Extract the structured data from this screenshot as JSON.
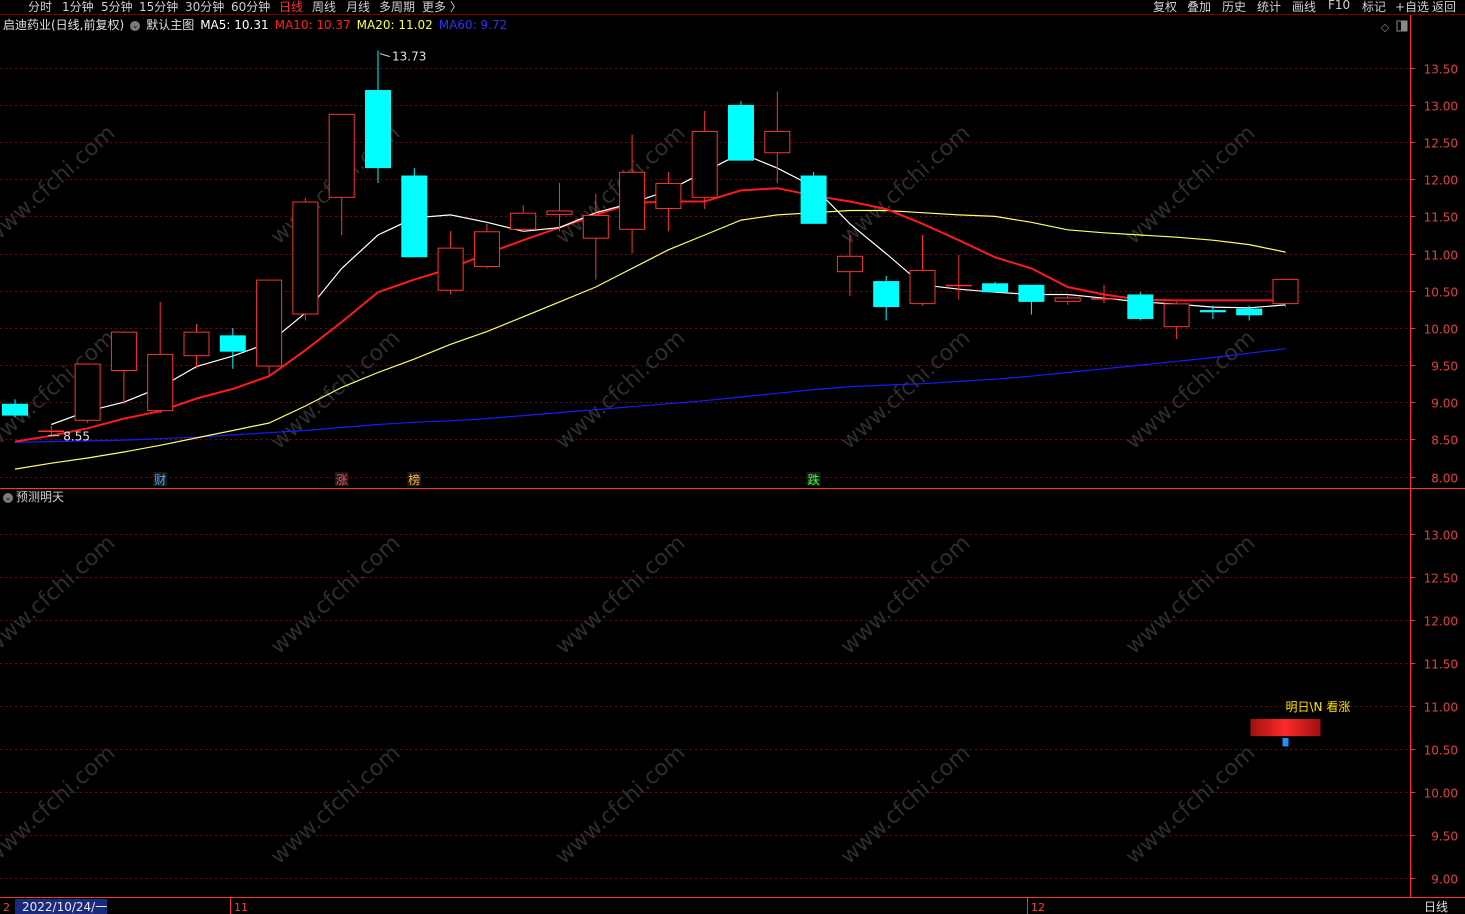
{
  "periods": [
    "分时",
    "1分钟",
    "5分钟",
    "15分钟",
    "30分钟",
    "60分钟",
    "日线",
    "周线",
    "月线",
    "多周期",
    "更多 〉"
  ],
  "active_period": "日线",
  "tools": [
    "复权",
    "叠加",
    "历史",
    "统计",
    "画线",
    "F10",
    "标记",
    "+自选",
    "返回"
  ],
  "main_legend": {
    "name": "启迪药业(日线,前复权)",
    "template": "默认主图",
    "ma5": "MA5: 10.31",
    "ma10": "MA10: 10.37",
    "ma20": "MA20: 11.02",
    "ma60": "MA60: 9.72"
  },
  "indicator_title": "预测明天",
  "period_tag": "日线",
  "colors": {
    "up": "#ff3232",
    "down": "#00ffff",
    "ma5": "#ffffff",
    "ma10": "#ff1a1a",
    "ma20": "#ffff66",
    "ma60": "#1a1aff",
    "grid": "#7a0000",
    "axis": "#ff3232"
  },
  "annotations": {
    "high": "13.73",
    "low": "8.55",
    "forecast": "明日\\N  看涨"
  },
  "markers": [
    {
      "text": "财",
      "index": 4,
      "color": "#4aa0ff"
    },
    {
      "text": "涨",
      "index": 9,
      "color": "#ff5050"
    },
    {
      "text": "榜",
      "index": 11,
      "color": "#ffb040"
    },
    {
      "text": "跌",
      "index": 22,
      "color": "#40ff40"
    }
  ],
  "dates": {
    "first": "2022/10/24/一",
    "m11": "11",
    "m12": "12",
    "lead": "2"
  },
  "chart_data": {
    "type": "candlestick",
    "main_ylim": [
      7.9,
      13.9
    ],
    "main_ticks": [
      "13.50",
      "13.00",
      "12.50",
      "12.00",
      "11.50",
      "11.00",
      "10.50",
      "10.00",
      "9.50",
      "9.00",
      "8.50",
      "8.00"
    ],
    "sub_ylim": [
      8.8,
      13.4
    ],
    "sub_ticks": [
      "13.00",
      "12.50",
      "12.00",
      "11.50",
      "11.00",
      "10.50",
      "10.00",
      "9.50",
      "9.00"
    ],
    "candles": [
      {
        "o": 8.98,
        "h": 9.04,
        "l": 8.8,
        "c": 8.82
      },
      {
        "o": 8.62,
        "h": 8.68,
        "l": 8.55,
        "c": 8.62
      },
      {
        "o": 8.75,
        "h": 9.52,
        "l": 8.72,
        "c": 9.52
      },
      {
        "o": 9.42,
        "h": 9.95,
        "l": 8.98,
        "c": 9.95
      },
      {
        "o": 8.88,
        "h": 10.35,
        "l": 8.85,
        "c": 9.65
      },
      {
        "o": 9.62,
        "h": 10.05,
        "l": 9.45,
        "c": 9.95
      },
      {
        "o": 9.9,
        "h": 10.0,
        "l": 9.45,
        "c": 9.68
      },
      {
        "o": 9.48,
        "h": 10.65,
        "l": 9.35,
        "c": 10.65
      },
      {
        "o": 10.18,
        "h": 11.75,
        "l": 10.1,
        "c": 11.7
      },
      {
        "o": 11.75,
        "h": 12.88,
        "l": 11.25,
        "c": 12.88
      },
      {
        "o": 13.2,
        "h": 13.73,
        "l": 11.95,
        "c": 12.15
      },
      {
        "o": 12.05,
        "h": 12.15,
        "l": 10.95,
        "c": 10.95
      },
      {
        "o": 10.5,
        "h": 11.3,
        "l": 10.45,
        "c": 11.08
      },
      {
        "o": 10.82,
        "h": 11.4,
        "l": 10.8,
        "c": 11.3
      },
      {
        "o": 11.32,
        "h": 11.65,
        "l": 11.3,
        "c": 11.55
      },
      {
        "o": 11.52,
        "h": 11.95,
        "l": 11.3,
        "c": 11.58
      },
      {
        "o": 11.2,
        "h": 11.8,
        "l": 10.65,
        "c": 11.52
      },
      {
        "o": 11.32,
        "h": 12.6,
        "l": 11.0,
        "c": 12.1
      },
      {
        "o": 11.6,
        "h": 12.1,
        "l": 11.3,
        "c": 11.95
      },
      {
        "o": 11.75,
        "h": 12.92,
        "l": 11.6,
        "c": 12.65
      },
      {
        "o": 13.0,
        "h": 13.05,
        "l": 12.25,
        "c": 12.25
      },
      {
        "o": 12.35,
        "h": 13.18,
        "l": 11.95,
        "c": 12.65
      },
      {
        "o": 12.05,
        "h": 12.1,
        "l": 11.4,
        "c": 11.4
      },
      {
        "o": 10.75,
        "h": 11.25,
        "l": 10.43,
        "c": 10.97
      },
      {
        "o": 10.63,
        "h": 10.7,
        "l": 10.1,
        "c": 10.28
      },
      {
        "o": 10.32,
        "h": 11.25,
        "l": 10.3,
        "c": 10.78
      },
      {
        "o": 10.58,
        "h": 10.98,
        "l": 10.38,
        "c": 10.58
      },
      {
        "o": 10.6,
        "h": 10.62,
        "l": 10.48,
        "c": 10.48
      },
      {
        "o": 10.58,
        "h": 10.58,
        "l": 10.18,
        "c": 10.35
      },
      {
        "o": 10.35,
        "h": 10.45,
        "l": 10.31,
        "c": 10.41
      },
      {
        "o": 10.4,
        "h": 10.58,
        "l": 10.33,
        "c": 10.4
      },
      {
        "o": 10.45,
        "h": 10.48,
        "l": 10.1,
        "c": 10.12
      },
      {
        "o": 10.01,
        "h": 10.35,
        "l": 9.85,
        "c": 10.33
      },
      {
        "o": 10.24,
        "h": 10.3,
        "l": 10.12,
        "c": 10.21
      },
      {
        "o": 10.26,
        "h": 10.3,
        "l": 10.1,
        "c": 10.17
      },
      {
        "o": 10.32,
        "h": 10.66,
        "l": 10.28,
        "c": 10.66
      }
    ],
    "ma5": [
      null,
      8.7,
      8.88,
      9.0,
      9.2,
      9.48,
      9.62,
      9.8,
      10.2,
      10.8,
      11.25,
      11.48,
      11.52,
      11.42,
      11.3,
      11.35,
      11.55,
      11.68,
      11.85,
      12.1,
      12.35,
      12.15,
      11.9,
      11.4,
      11.0,
      10.58,
      10.52,
      10.48,
      10.45,
      10.45,
      10.4,
      10.35,
      10.32,
      10.28,
      10.27,
      10.31
    ],
    "ma10": [
      8.47,
      8.55,
      8.65,
      8.78,
      8.88,
      9.05,
      9.18,
      9.35,
      9.7,
      10.08,
      10.48,
      10.65,
      10.8,
      11.0,
      11.18,
      11.35,
      11.52,
      11.68,
      11.7,
      11.7,
      11.85,
      11.88,
      11.78,
      11.7,
      11.6,
      11.4,
      11.18,
      10.95,
      10.8,
      10.55,
      10.45,
      10.38,
      10.37,
      10.37,
      10.37,
      10.37
    ],
    "ma20": [
      8.1,
      8.18,
      8.25,
      8.33,
      8.42,
      8.52,
      8.62,
      8.72,
      8.95,
      9.2,
      9.4,
      9.58,
      9.78,
      9.95,
      10.15,
      10.35,
      10.55,
      10.8,
      11.05,
      11.25,
      11.45,
      11.52,
      11.55,
      11.58,
      11.58,
      11.55,
      11.52,
      11.5,
      11.42,
      11.32,
      11.28,
      11.25,
      11.22,
      11.18,
      11.12,
      11.02
    ],
    "ma60": [
      8.46,
      8.47,
      8.48,
      8.49,
      8.51,
      8.53,
      8.56,
      8.59,
      8.62,
      8.66,
      8.7,
      8.73,
      8.75,
      8.78,
      8.82,
      8.86,
      8.9,
      8.94,
      8.98,
      9.02,
      9.07,
      9.12,
      9.17,
      9.21,
      9.23,
      9.25,
      9.28,
      9.31,
      9.35,
      9.4,
      9.45,
      9.5,
      9.55,
      9.6,
      9.66,
      9.72
    ],
    "forecast": {
      "bar_top": 10.85,
      "bar_bottom": 10.65,
      "marker_top": 10.63,
      "marker_bottom": 10.53
    },
    "watermark": "www.cfchi.com"
  }
}
